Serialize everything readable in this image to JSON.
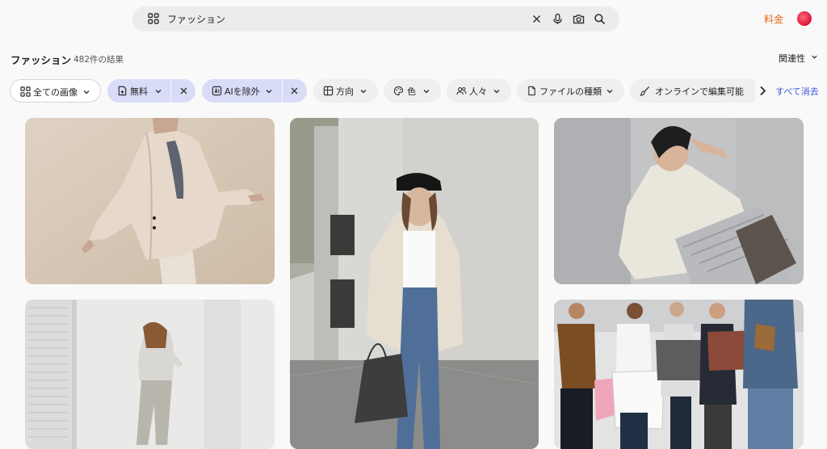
{
  "search": {
    "query": "ファッション"
  },
  "header": {
    "pricing_label": "料金"
  },
  "results": {
    "title": "ファッション",
    "count": "482件の結果",
    "sort_label": "関連性"
  },
  "filters": [
    {
      "label": "全ての画像",
      "icon": "grid-icon",
      "state": "outline"
    },
    {
      "label": "無料",
      "icon": "free-tag-icon",
      "state": "active",
      "removable": true
    },
    {
      "label": "AIを除外",
      "icon": "ai-icon",
      "state": "active",
      "removable": true
    },
    {
      "label": "方向",
      "icon": "orientation-icon",
      "state": "default"
    },
    {
      "label": "色",
      "icon": "palette-icon",
      "state": "default"
    },
    {
      "label": "人々",
      "icon": "people-icon",
      "state": "default"
    },
    {
      "label": "ファイルの種類",
      "icon": "file-icon",
      "state": "default"
    },
    {
      "label": "オンラインで編集可能",
      "icon": "brush-icon",
      "state": "default"
    }
  ],
  "clear_all_label": "すべて消去",
  "images": [
    {
      "subject": "woman in beige blazer, arms outstretched"
    },
    {
      "subject": "woman in black cap and jeans holding tote bag"
    },
    {
      "subject": "woman in white shirt and pleated skirt seated"
    },
    {
      "subject": "woman in white blouse against white wall"
    },
    {
      "subject": "group of shoppers holding shopping bags"
    }
  ],
  "colors": {
    "accent": "#e36b1b",
    "link": "#3b59d6",
    "chip_active": "#d8dcf7"
  }
}
